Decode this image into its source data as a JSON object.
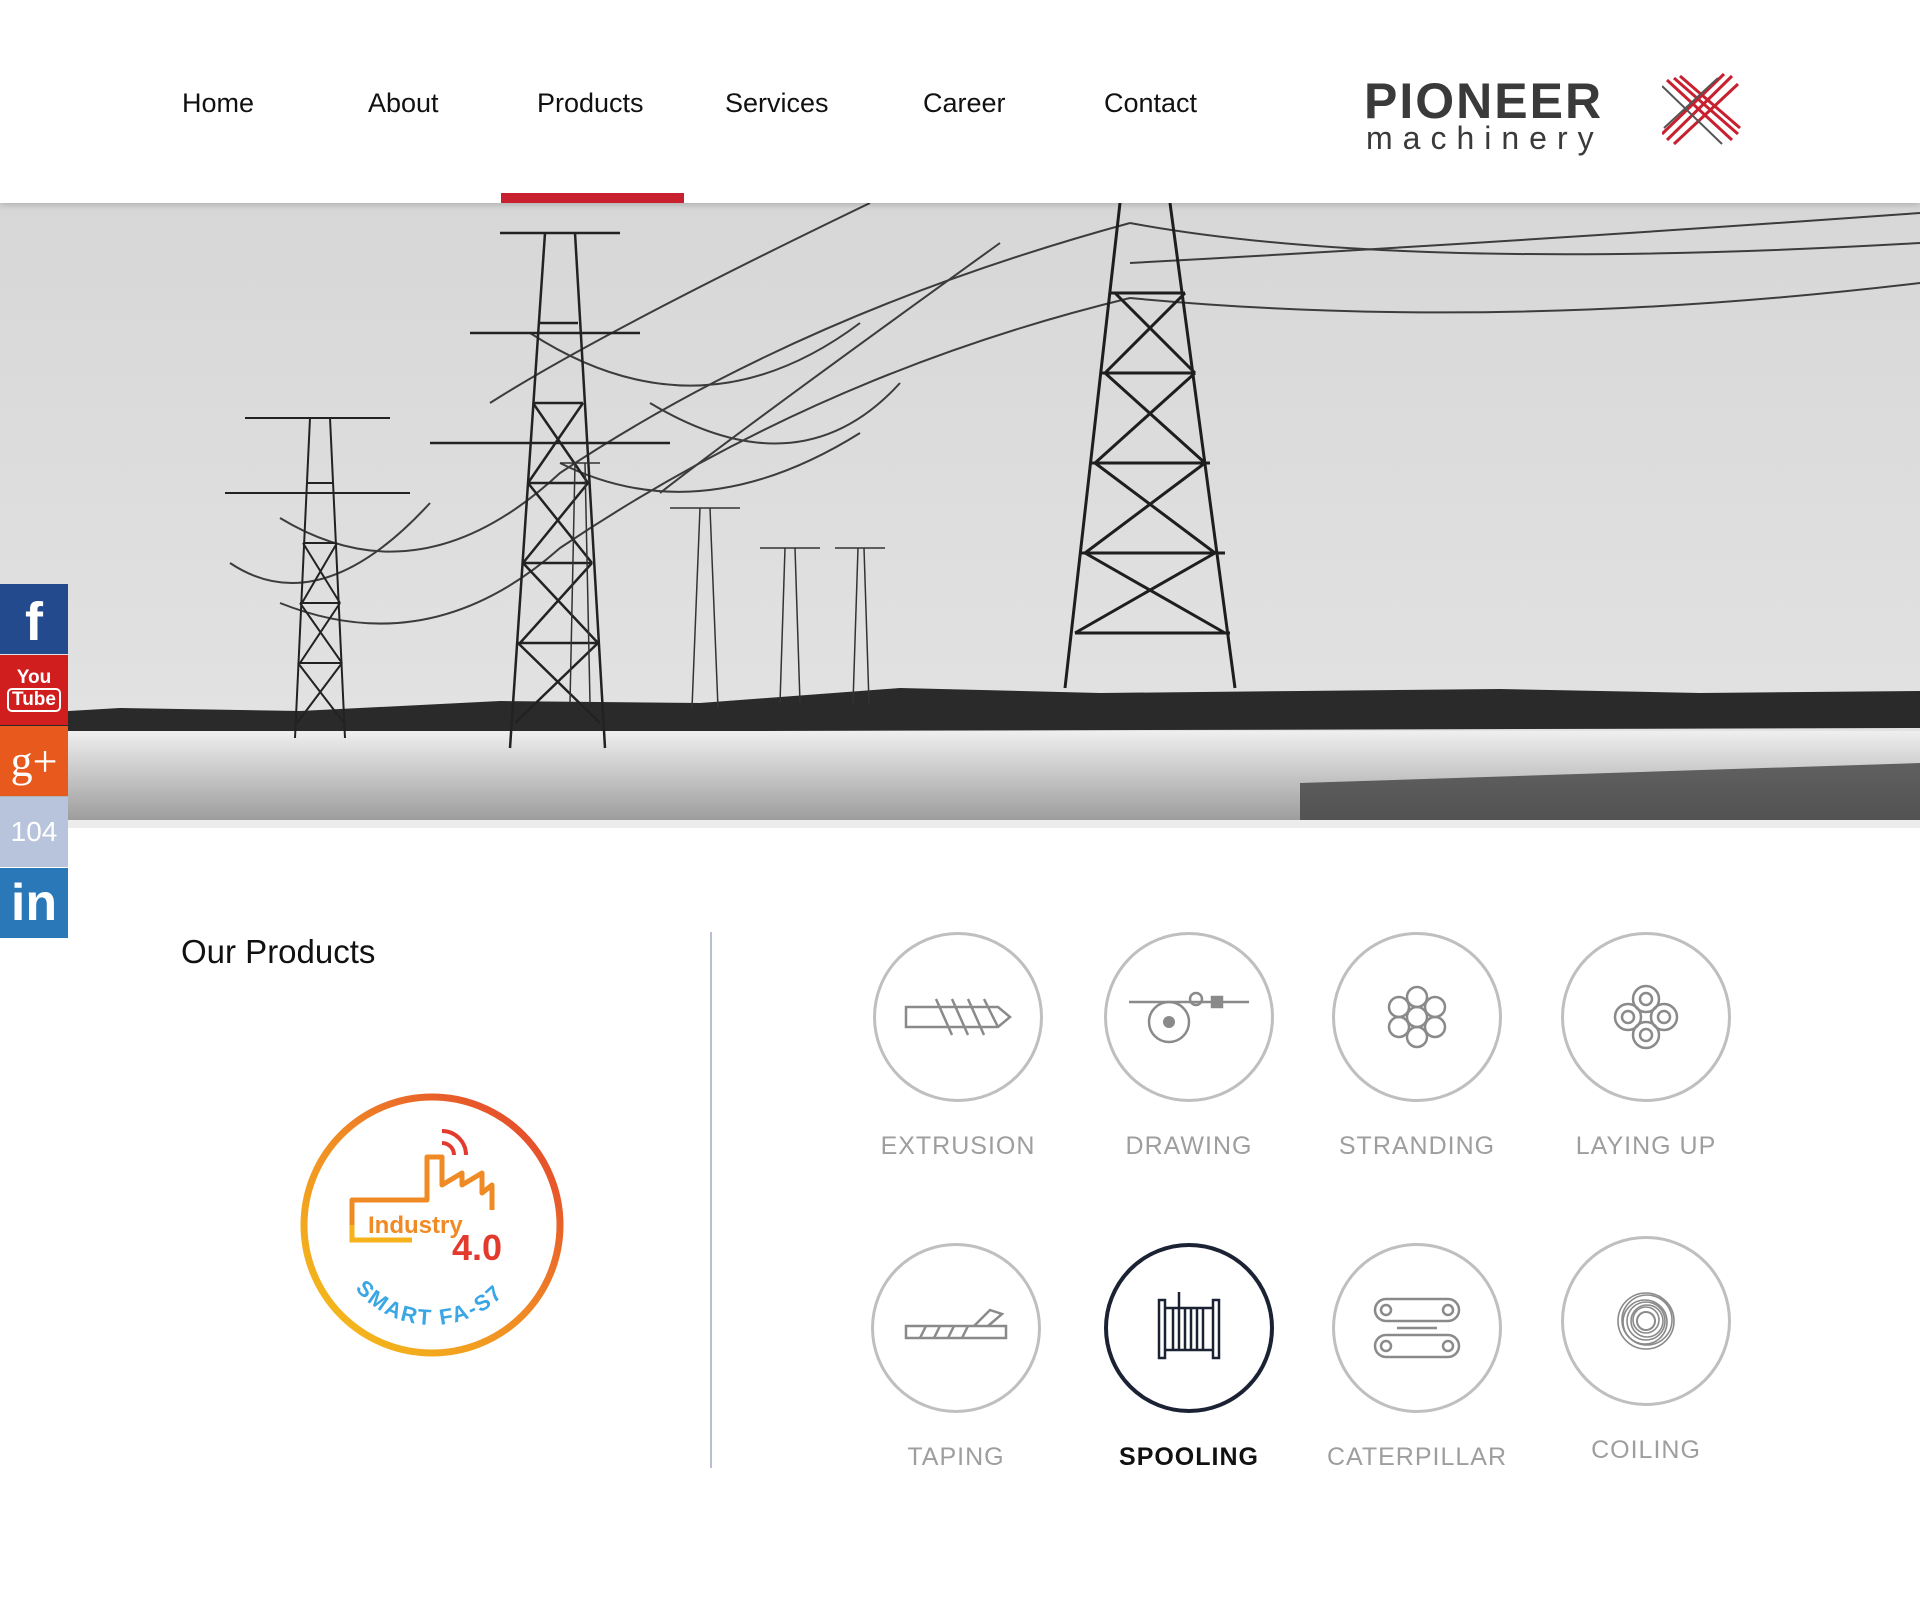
{
  "nav": {
    "items": [
      {
        "label": "Home"
      },
      {
        "label": "About"
      },
      {
        "label": "Products"
      },
      {
        "label": "Services"
      },
      {
        "label": "Career"
      },
      {
        "label": "Contact"
      }
    ],
    "active": "Products"
  },
  "logo": {
    "main": "PIONEER",
    "sub": "machinery"
  },
  "social": {
    "facebook": "f",
    "youtube_top": "You",
    "youtube_bottom": "Tube",
    "googleplus": "g+",
    "job104": "104",
    "linkedin": "in"
  },
  "section": {
    "title": "Our Products"
  },
  "badge": {
    "line1": "Industry",
    "line2": "4.0",
    "arc": "SMART FA-S7"
  },
  "products": [
    {
      "label": "EXTRUSION",
      "icon": "extrusion-icon"
    },
    {
      "label": "DRAWING",
      "icon": "drawing-icon"
    },
    {
      "label": "STRANDING",
      "icon": "stranding-icon"
    },
    {
      "label": "LAYING UP",
      "icon": "laying-up-icon"
    },
    {
      "label": "TAPING",
      "icon": "taping-icon"
    },
    {
      "label": "SPOOLING",
      "icon": "spooling-icon",
      "active": true
    },
    {
      "label": "CATERPILLAR",
      "icon": "caterpillar-icon"
    },
    {
      "label": "COILING",
      "icon": "coiling-icon"
    }
  ],
  "colors": {
    "accent": "#c8202f",
    "active_border": "#1a2233",
    "inactive": "#9e9e9e",
    "divider": "#b9bfd0"
  }
}
